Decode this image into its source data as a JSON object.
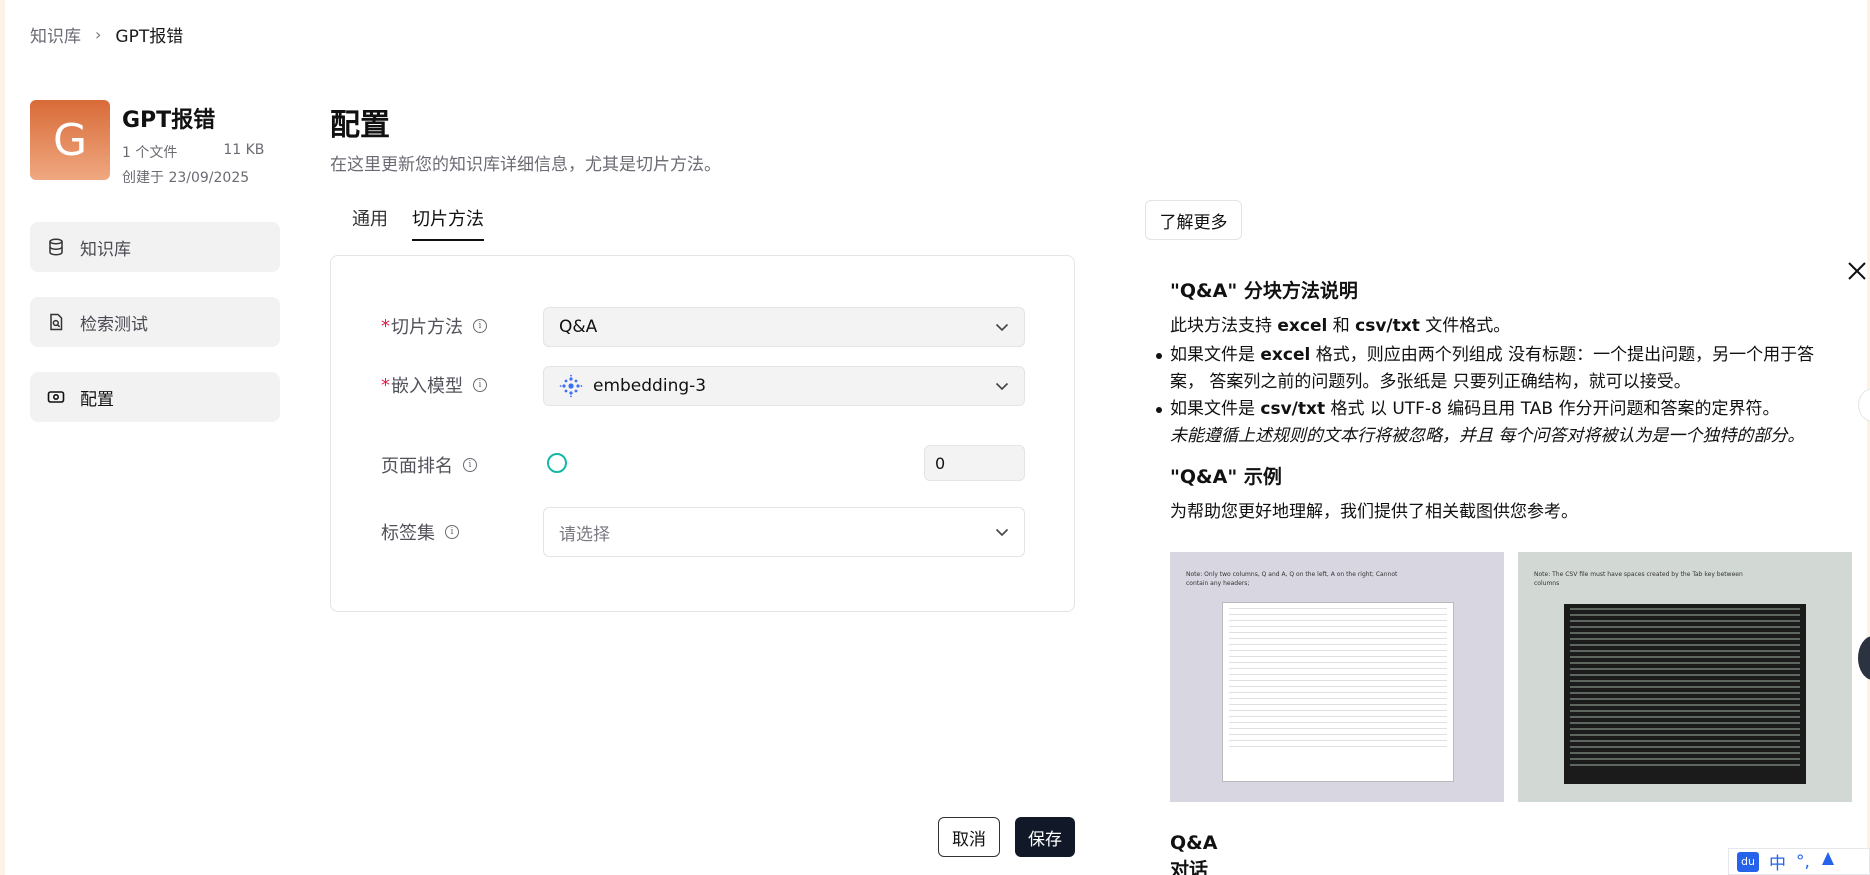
{
  "breadcrumb": {
    "root": "知识库",
    "separator": "›",
    "current": "GPT报错"
  },
  "kb": {
    "avatar_letter": "G",
    "title": "GPT报错",
    "file_count": "1 个文件",
    "size": "11 KB",
    "created": "创建于 23/09/2025"
  },
  "sidebar": {
    "items": [
      {
        "label": "知识库",
        "icon": "database-icon"
      },
      {
        "label": "检索测试",
        "icon": "file-search-icon"
      },
      {
        "label": "配置",
        "icon": "settings-icon",
        "active": true
      }
    ]
  },
  "main": {
    "title": "配置",
    "subtitle": "在这里更新您的知识库详细信息，尤其是切片方法。",
    "tabs": [
      {
        "label": "通用"
      },
      {
        "label": "切片方法",
        "active": true
      }
    ],
    "form": {
      "chunk_method": {
        "required_mark": "*",
        "label": "切片方法",
        "value": "Q&A"
      },
      "embedding_model": {
        "required_mark": "*",
        "label": "嵌入模型",
        "value": "embedding-3"
      },
      "page_rank": {
        "label": "页面排名",
        "value": "0"
      },
      "tag_set": {
        "label": "标签集",
        "placeholder": "请选择"
      }
    },
    "cancel_label": "取消",
    "save_label": "保存"
  },
  "help": {
    "learn_more_label": "了解更多",
    "heading": "\"Q&A\" 分块方法说明",
    "intro_pre": "此块方法支持 ",
    "intro_b1": "excel",
    "intro_mid": " 和 ",
    "intro_b2": "csv/txt",
    "intro_post": " 文件格式。",
    "bullet1_pre": "如果文件是 ",
    "bullet1_b": "excel",
    "bullet1_post": " 格式，则应由两个列组成 没有标题：一个提出问题，另一个用于答案， 答案列之前的问题列。多张纸是 只要列正确结构，就可以接受。",
    "bullet2_pre": "如果文件是 ",
    "bullet2_b": "csv/txt",
    "bullet2_post": " 格式 以 UTF-8 编码且用 TAB 作分开问题和答案的定界符。",
    "italic_note": "未能遵循上述规则的文本行将被忽略，并且 每个问答对将被认为是一个独特的部分。",
    "example_heading": "\"Q&A\" 示例",
    "example_text": "为帮助您更好地理解，我们提供了相关截图供您参考。",
    "shot1_note": "Note: Only two columns, Q and A, Q on the left, A on the right; Cannot contain any headers;",
    "shot2_note": "Note: The CSV file must have spaces created by the Tab key between columns",
    "qa_heading": "Q&A 对话示例"
  },
  "ime": {
    "logo": "du",
    "mode": "中",
    "punct": "°,"
  }
}
